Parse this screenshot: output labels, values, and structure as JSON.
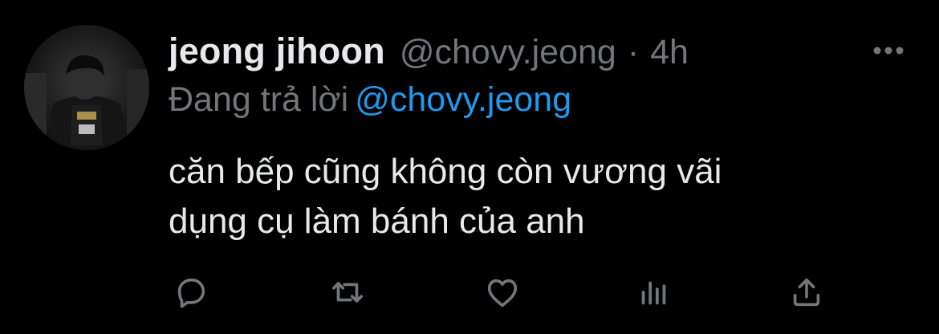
{
  "tweet": {
    "display_name": "jeong jihoon",
    "handle": "@chovy.jeong",
    "separator": "·",
    "time": "4h",
    "reply_prefix": "Đang trả lời",
    "reply_mention": "@chovy.jeong",
    "text_lines": [
      "căn bếp cũng không còn vương vãi",
      "dụng cụ làm bánh của anh"
    ]
  },
  "actions": [
    {
      "name": "reply-button",
      "icon": "reply-icon"
    },
    {
      "name": "retweet-button",
      "icon": "retweet-icon"
    },
    {
      "name": "like-button",
      "icon": "heart-icon"
    },
    {
      "name": "analytics-button",
      "icon": "analytics-icon"
    },
    {
      "name": "share-button",
      "icon": "share-icon"
    }
  ],
  "colors": {
    "background": "#000000",
    "primary_text": "#e7e9ea",
    "secondary_text": "#71767b",
    "link": "#1d9bf0"
  }
}
